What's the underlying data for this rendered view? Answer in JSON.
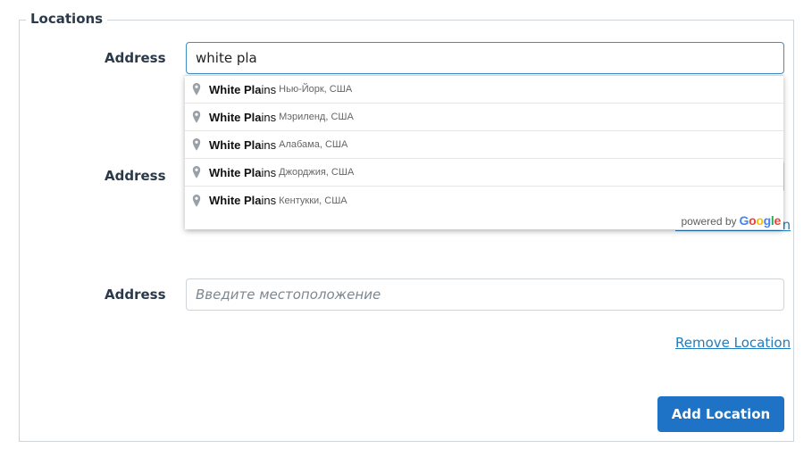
{
  "section": {
    "legend": "Locations"
  },
  "rows": [
    {
      "label": "Address",
      "value": "white pla"
    },
    {
      "label": "Address",
      "value": ""
    },
    {
      "label": "Address",
      "placeholder": "Введите местоположение"
    }
  ],
  "suggestions": [
    {
      "match": "White Pla",
      "rest": "ins",
      "secondary": "Нью-Йорк, США"
    },
    {
      "match": "White Pla",
      "rest": "ins",
      "secondary": "Мэриленд, США"
    },
    {
      "match": "White Pla",
      "rest": "ins",
      "secondary": "Алабама, США"
    },
    {
      "match": "White Pla",
      "rest": "ins",
      "secondary": "Джорджия, США"
    },
    {
      "match": "White Pla",
      "rest": "ins",
      "secondary": "Кентукки, США"
    }
  ],
  "powered_by": {
    "text": "powered by",
    "brand": [
      "G",
      "o",
      "o",
      "g",
      "l",
      "e"
    ],
    "brand_colors": [
      "#4285F4",
      "#EA4335",
      "#FBBC05",
      "#4285F4",
      "#34A853",
      "#EA4335"
    ]
  },
  "actions": {
    "remove_location": "Remove Location",
    "add_location": "Add Location"
  },
  "icons": {
    "suggestion": "map-pin-icon"
  }
}
